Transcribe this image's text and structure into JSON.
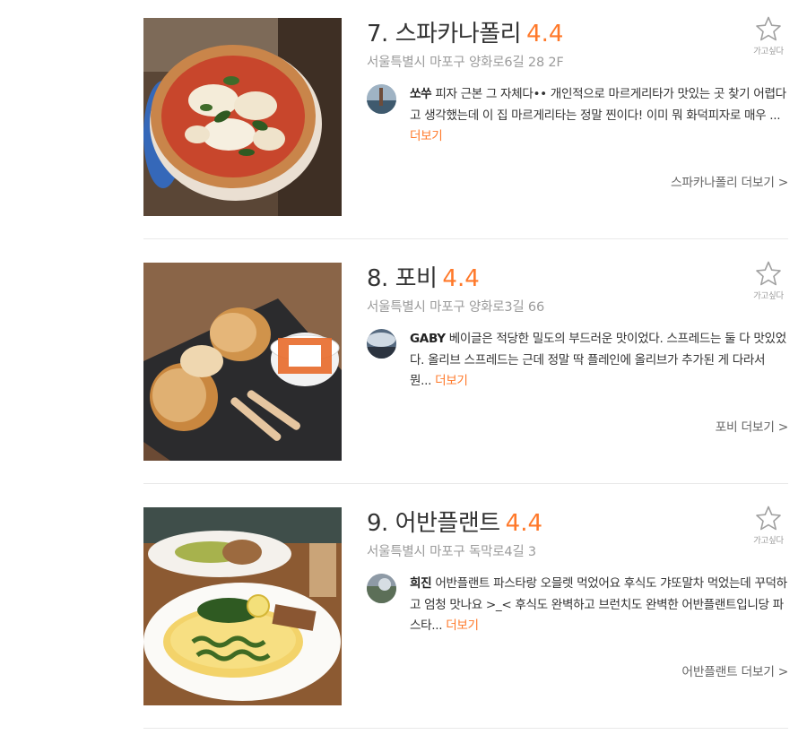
{
  "restaurants": [
    {
      "title": "7. 스파카나폴리",
      "rating": "4.4",
      "address": "서울특별시 마포구 양화로6길 28 2F",
      "wish_label": "가고싶다",
      "reviewer": "쏘쑤",
      "review": "피자 근본 그 자체다•• 개인적으로 마르게리타가 맛있는 곳 찾기 어렵다고 생각했는데 이 집 마르게리타는 정말 찐이다! 이미 뭐 화덕피자로 매우 ...",
      "more_label": "더보기",
      "link_label": "스파카나폴리 더보기 >",
      "photo_icon": "margherita-pizza-photo"
    },
    {
      "title": "8. 포비",
      "rating": "4.4",
      "address": "서울특별시 마포구 양화로3길 66",
      "wish_label": "가고싶다",
      "reviewer": "GABY",
      "review": "베이글은 적당한 밀도의 부드러운 맛이었다. 스프레드는 둘 다 맛있었다. 올리브 스프레드는 근데 정말 딱 플레인에 올리브가 추가된 게 다라서 뭔...",
      "more_label": "더보기",
      "link_label": "포비 더보기 >",
      "photo_icon": "bagel-spread-photo"
    },
    {
      "title": "9. 어반플랜트",
      "rating": "4.4",
      "address": "서울특별시 마포구 독막로4길 3",
      "wish_label": "가고싶다",
      "reviewer": "희진",
      "review": "어반플랜트 파스타랑 오믈렛 먹었어요 후식도 갸또말차 먹었는데 꾸덕하고 엄청 맛나요 >_< 후식도 완벽하고 브런치도 완벽한 어반플랜트입니당 파스타...",
      "more_label": "더보기",
      "link_label": "어반플랜트 더보기 >",
      "photo_icon": "omelette-brunch-photo"
    }
  ],
  "colors": {
    "accent": "#ff792a",
    "text": "#333333",
    "muted": "#9b9b9b",
    "divider": "#e9e9e9"
  }
}
